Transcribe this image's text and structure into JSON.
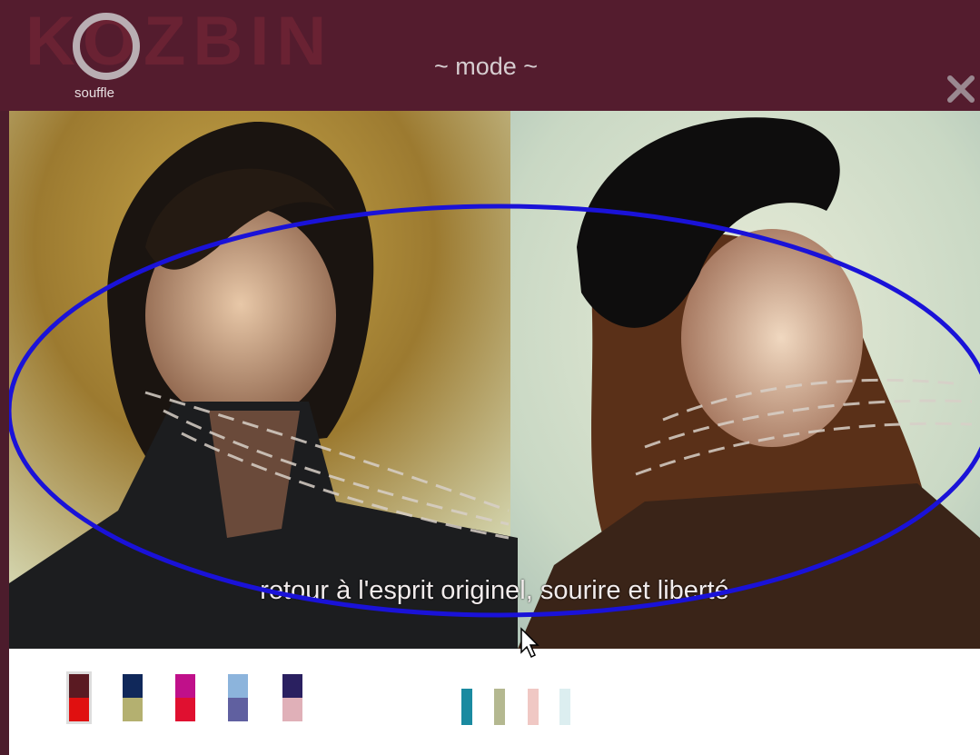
{
  "header": {
    "brand": "KOZBIN",
    "logo_label": "souffle",
    "title": "~ mode ~"
  },
  "close_icon": "close-icon",
  "photo": {
    "caption": "retour à l'esprit originel, sourire et liberté",
    "overlay_color": "#1a12d8"
  },
  "palette": {
    "groups": [
      {
        "name": "outfit-swatches",
        "items": [
          {
            "top": "#5a1a22",
            "bottom": "#e01010"
          },
          {
            "top": "#10285a",
            "bottom": "#b4b070"
          },
          {
            "top": "#c0108a",
            "bottom": "#e01030"
          },
          {
            "top": "#8cb4dc",
            "bottom": "#6060a0"
          },
          {
            "top": "#2a2060",
            "bottom": "#e0b0b8"
          }
        ]
      },
      {
        "name": "tone-swatches",
        "items": [
          {
            "top": "#1a8aa0",
            "bottom": "#1a8aa0"
          },
          {
            "top": "#b4b890",
            "bottom": "#b4b890"
          },
          {
            "top": "#f0c8c4",
            "bottom": "#f0c8c4"
          },
          {
            "top": "#dceef0",
            "bottom": "#dceef0"
          }
        ]
      }
    ]
  }
}
